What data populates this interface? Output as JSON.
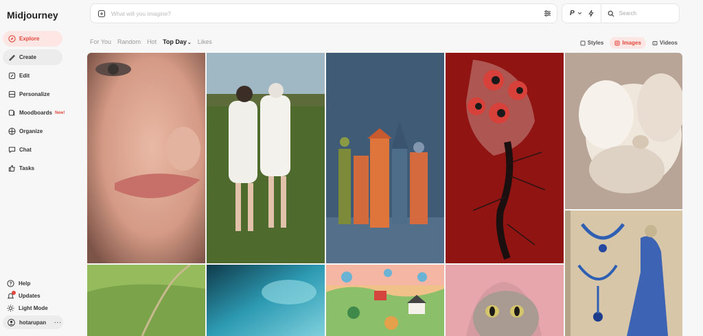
{
  "app": {
    "title": "Midjourney"
  },
  "sidebar": {
    "items": [
      {
        "label": "Explore",
        "icon": "compass-icon"
      },
      {
        "label": "Create",
        "icon": "brush-icon"
      },
      {
        "label": "Edit",
        "icon": "edit-icon"
      },
      {
        "label": "Personalize",
        "icon": "personalize-icon"
      },
      {
        "label": "Moodboards",
        "icon": "moodboard-icon",
        "badge": "New!"
      },
      {
        "label": "Organize",
        "icon": "grid-icon"
      },
      {
        "label": "Chat",
        "icon": "chat-icon"
      },
      {
        "label": "Tasks",
        "icon": "thumbs-up-icon"
      }
    ],
    "bottom": [
      {
        "label": "Help",
        "icon": "help-icon"
      },
      {
        "label": "Updates",
        "icon": "bell-icon"
      },
      {
        "label": "Light Mode",
        "icon": "sun-icon"
      }
    ],
    "user": {
      "name": "hotarupan",
      "more": "···"
    }
  },
  "prompt": {
    "placeholder": "What will you imagine?"
  },
  "toolbar": {
    "p_label": "P",
    "search_placeholder": "Search"
  },
  "tabs": [
    "For You",
    "Random",
    "Hot",
    "Top Day",
    "Likes"
  ],
  "active_tab": "Top Day",
  "types": [
    "Styles",
    "Images",
    "Videos"
  ],
  "active_type": "Images",
  "colors": {
    "accent": "#e2483d",
    "accent_bg": "#fde6e4"
  }
}
